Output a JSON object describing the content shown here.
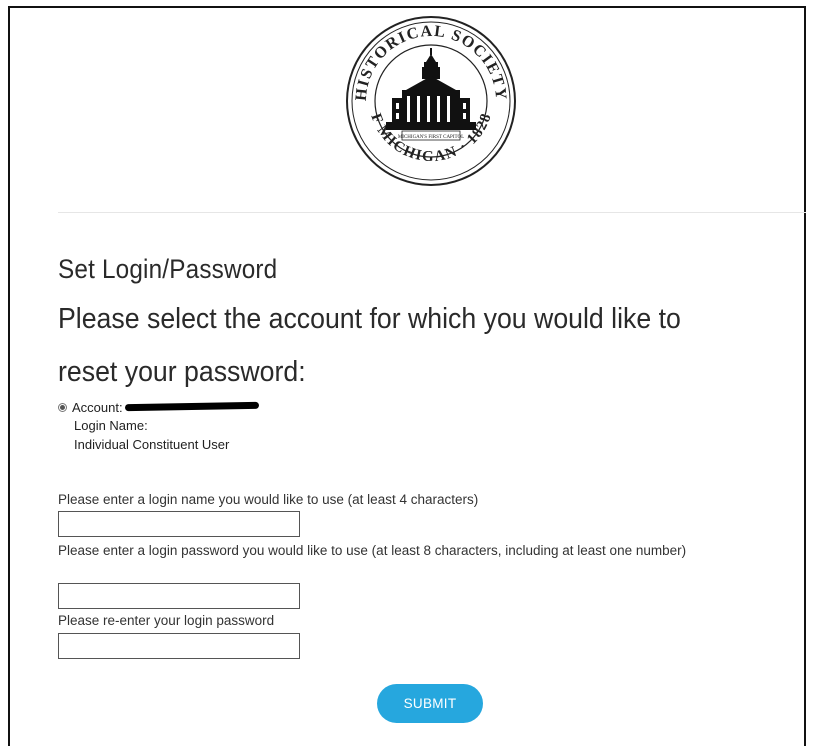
{
  "seal": {
    "top_text": "HISTORICAL SOCIETY",
    "bottom_text": "OF MICHIGAN · 1828 ·",
    "banner_text": "MICHIGAN'S FIRST CAPITOL"
  },
  "page": {
    "title": "Set Login/Password",
    "instruction_line1": "Please select the account for which you would like to",
    "instruction_line2": "reset your password:"
  },
  "account": {
    "label": "Account:",
    "login_name_label": "Login Name:",
    "user_type": "Individual Constituent User"
  },
  "form": {
    "login_name_label": "Please enter a login name you would like to use (at least 4 characters)",
    "login_name_value": "",
    "password_label": "Please enter a login password you would like to use (at least 8 characters, including at least one number)",
    "password_value": "",
    "confirm_label": "Please re-enter your login password",
    "confirm_value": "",
    "submit_label": "SUBMIT"
  },
  "colors": {
    "accent": "#26a7de"
  }
}
